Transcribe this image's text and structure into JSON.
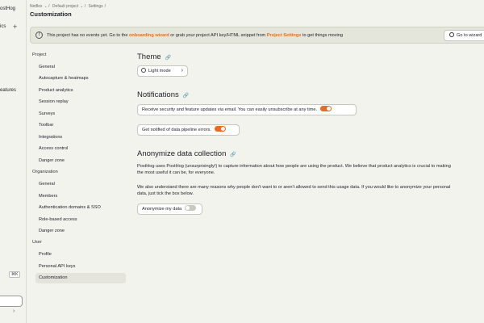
{
  "rail": {
    "brand_fragment": "ostHog",
    "analytics_fragment": "ics",
    "plus": "+",
    "features_fragment": "eatures",
    "kbd": "⌘K",
    "collapse": "›"
  },
  "breadcrumb": [
    "Netflex",
    "Default project",
    "Settings"
  ],
  "page_title": "Customization",
  "banner": {
    "icon": "!",
    "text_before": "This project has no events yet. Go to the ",
    "link1": "onboarding wizard",
    "text_middle": " or grab your project API key/HTML snippet from ",
    "link2": "Project Settings",
    "text_after": " to get things moving",
    "button": "Go to wizard"
  },
  "nav": {
    "project_header": "Project",
    "project_items": [
      "General",
      "Autocapture & heatmaps",
      "Product analytics",
      "Session replay",
      "Surveys",
      "Toolbar",
      "Integrations",
      "Access control",
      "Danger zone"
    ],
    "org_header": "Organization",
    "org_items": [
      "General",
      "Members",
      "Authentication domains & SSO",
      "Role-based access",
      "Danger zone"
    ],
    "user_header": "User",
    "user_items": [
      "Profile",
      "Personal API keys",
      "Customization"
    ]
  },
  "theme": {
    "heading": "Theme",
    "button": "Light mode"
  },
  "notifications": {
    "heading": "Notifications",
    "email_updates": "Receive security and feature updates via email. You can easily unsubscribe at any time.",
    "email_updates_on": true,
    "pipeline_errors": "Get notified of data pipeline errors.",
    "pipeline_errors_on": true
  },
  "anonymize": {
    "heading": "Anonymize data collection",
    "para1_line1": "PostHog uses PostHog (unsurprisingly!) to capture information about how people are using the product. We believe that product analytics is crucial to making",
    "para1_line2": "the most useful it can be, for everyone.",
    "para2_line1": "We also understand there are many reasons why people don't want to or aren't allowed to send this usage data. If you would like to anonymize your personal",
    "para2_line2": "data, just tick the box below.",
    "toggle_label": "Anonymize my data",
    "toggle_on": false
  },
  "colors": {
    "accent": "#eb6a1c",
    "background": "#f3f3ee"
  }
}
